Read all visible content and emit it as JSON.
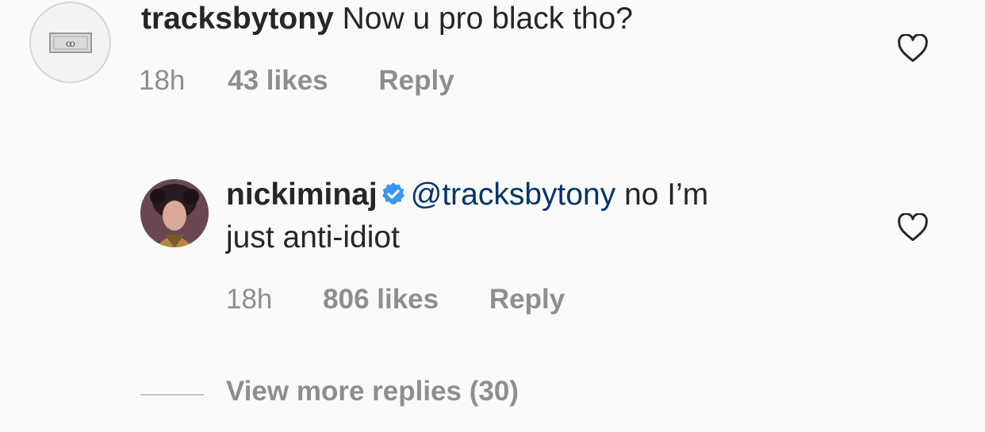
{
  "comments": [
    {
      "username": "tracksbytony",
      "text": "Now u pro black tho?",
      "time": "18h",
      "likes": "43 likes",
      "reply_label": "Reply",
      "avatar_icon": "currency-bill-avatar"
    },
    {
      "username": "nickiminaj",
      "verified": true,
      "mention": "@tracksbytony",
      "text_line1": "no I’m",
      "text_line2": "just anti-idiot",
      "time": "18h",
      "likes": "806 likes",
      "reply_label": "Reply",
      "avatar_icon": "profile-photo-avatar"
    }
  ],
  "view_more": "View more replies (30)",
  "colors": {
    "background": "#fafafa",
    "text": "#262626",
    "muted": "#8e8e8e",
    "mention": "#003569",
    "verified": "#3897f0"
  },
  "icons": [
    "heart-icon",
    "verified-badge-icon"
  ]
}
